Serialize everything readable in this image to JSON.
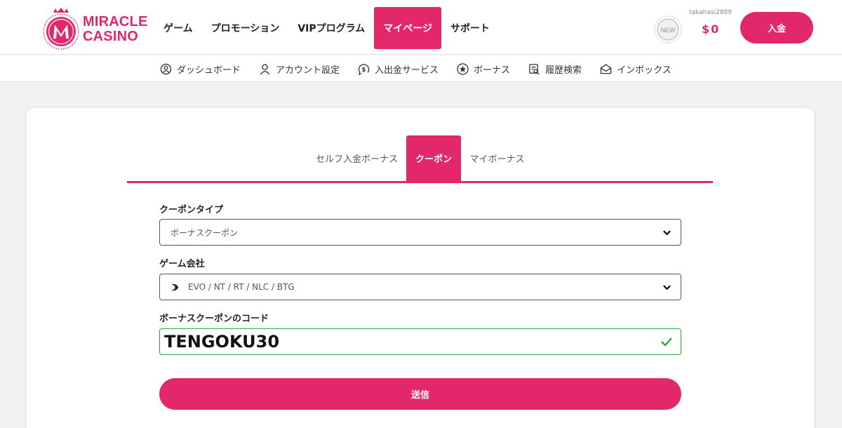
{
  "brand": {
    "line1": "MIRACLE",
    "line2": "CASINO",
    "color": "#e3276b"
  },
  "nav": [
    {
      "label": "ゲーム",
      "active": false
    },
    {
      "label": "プロモーション",
      "active": false
    },
    {
      "label": "VIPプログラム",
      "active": false
    },
    {
      "label": "マイページ",
      "active": true
    },
    {
      "label": "サポート",
      "active": false
    }
  ],
  "user": {
    "badge": "NEW",
    "username": "takahasi2889",
    "balance": "$0",
    "deposit_label": "入金"
  },
  "subnav": [
    {
      "label": "ダッシュボード",
      "icon": "dashboard-icon"
    },
    {
      "label": "アカウント設定",
      "icon": "user-icon"
    },
    {
      "label": "入出金サービス",
      "icon": "dollar-icon"
    },
    {
      "label": "ボーナス",
      "icon": "star-icon"
    },
    {
      "label": "履歴検索",
      "icon": "history-search-icon"
    },
    {
      "label": "インボックス",
      "icon": "envelope-icon"
    }
  ],
  "tabs": [
    {
      "label": "セルフ入金ボーナス",
      "active": false
    },
    {
      "label": "クーポン",
      "active": true
    },
    {
      "label": "マイボーナス",
      "active": false
    }
  ],
  "form": {
    "coupon_type_label": "クーポンタイプ",
    "coupon_type_value": "ボーナスクーポン",
    "provider_label": "ゲーム会社",
    "provider_value": "EVO / NT / RT / NLC / BTG",
    "code_label": "ボーナスクーポンのコード",
    "code_value": "TENGOKU30",
    "submit_label": "送信"
  },
  "colors": {
    "accent": "#e3276b",
    "valid": "#28a745"
  }
}
